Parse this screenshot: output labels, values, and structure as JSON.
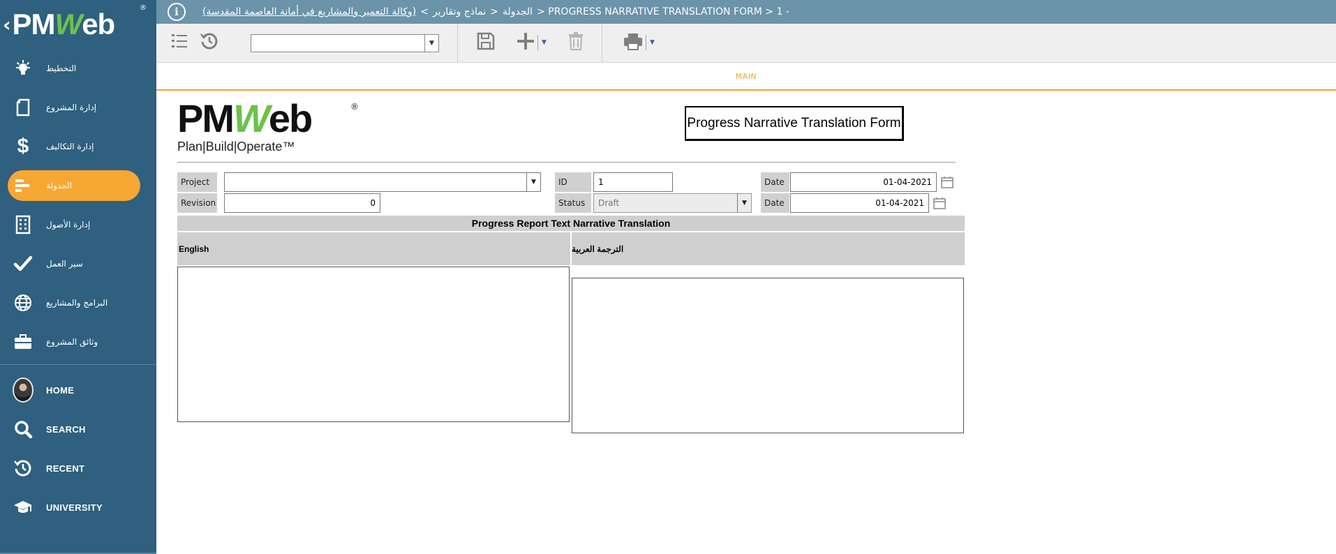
{
  "app": {
    "brand": "PMWeb",
    "brand_prefix": "PM",
    "brand_w": "W",
    "brand_suffix": "eb",
    "registered": "®"
  },
  "sidebar": {
    "items": [
      {
        "label": "التخطيط",
        "icon": "lightbulb-icon"
      },
      {
        "label": "إدارة المشروع",
        "icon": "document-icon"
      },
      {
        "label": "إدارة التكاليف",
        "icon": "dollar-icon"
      },
      {
        "label": "الجدولة",
        "icon": "gantt-icon",
        "active": true
      },
      {
        "label": "إدارة الأصول",
        "icon": "building-icon"
      },
      {
        "label": "سير العمل",
        "icon": "checkmark-icon"
      },
      {
        "label": "البرامج والمشاريع",
        "icon": "globe-icon"
      },
      {
        "label": "وثائق المشروع",
        "icon": "briefcase-icon"
      }
    ],
    "system": [
      {
        "label": "HOME",
        "icon": "avatar"
      },
      {
        "label": "SEARCH",
        "icon": "search-icon"
      },
      {
        "label": "RECENT",
        "icon": "recent-icon"
      },
      {
        "label": "UNIVERSITY",
        "icon": "graduation-cap-icon"
      }
    ],
    "active_color": "#f7a733",
    "bg_color": "#2f607f"
  },
  "topbar": {
    "info_glyph": "i",
    "breadcrumb": {
      "link": "(وكالة التعمير والمشاريع في أمانة العاصمة المقدسة)",
      "sep1": "<",
      "part2": "الجدولة",
      "sep2": ">",
      "part3": "نماذج وتقارير",
      "rest": "> PROGRESS NARRATIVE TRANSLATION FORM > 1 -"
    }
  },
  "toolbar": {
    "view_select_value": "",
    "buttons": [
      "list-icon",
      "history-icon",
      "save-icon",
      "add-icon",
      "delete-icon",
      "print-icon"
    ]
  },
  "tabs": [
    {
      "label": "MAIN",
      "active": true
    }
  ],
  "form": {
    "logo_tagline": "Plan|Build|Operate™",
    "title": "Progress Narrative Translation Form",
    "fields": {
      "project_label": "Project",
      "project_value": "",
      "revision_label": "Revision",
      "revision_value": "0",
      "id_label": "ID",
      "id_value": "1",
      "status_label": "Status",
      "status_value": "Draft",
      "date1_label": "Date",
      "date1_value": "01-04-2021",
      "date2_label": "Date",
      "date2_value": "01-04-2021"
    },
    "section_title": "Progress Report Text Narrative Translation",
    "english_label": "English",
    "arabic_label": "الترجمة العربية",
    "english_text": "",
    "arabic_text": ""
  }
}
